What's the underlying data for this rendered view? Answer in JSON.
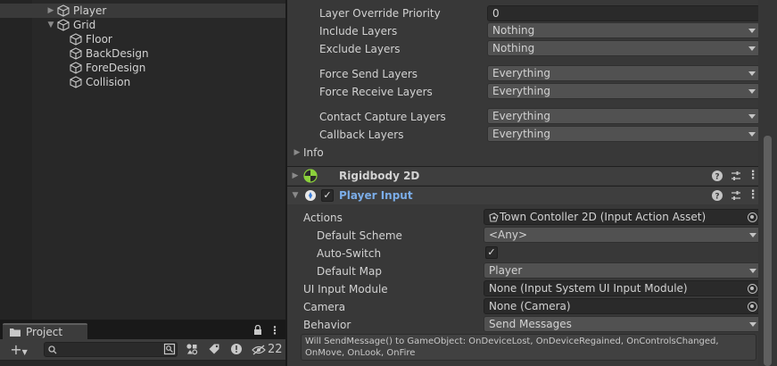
{
  "hierarchy": {
    "items": [
      {
        "label": "Player",
        "expanded": false,
        "icon": "cube-icon"
      },
      {
        "label": "Grid",
        "expanded": true,
        "icon": "cube-icon"
      },
      {
        "label": "Floor",
        "icon": "cube-icon"
      },
      {
        "label": "BackDesign",
        "icon": "cube-icon"
      },
      {
        "label": "ForeDesign",
        "icon": "cube-icon"
      },
      {
        "label": "Collision",
        "icon": "cube-icon"
      }
    ]
  },
  "project": {
    "tab_label": "Project",
    "tab_icon": "folder-icon",
    "search_placeholder": "",
    "hidden_count": "22"
  },
  "inspector": {
    "layer_override_priority": {
      "label": "Layer Override Priority",
      "value": "0"
    },
    "include_layers": {
      "label": "Include Layers",
      "value": "Nothing"
    },
    "exclude_layers": {
      "label": "Exclude Layers",
      "value": "Nothing"
    },
    "force_send_layers": {
      "label": "Force Send Layers",
      "value": "Everything"
    },
    "force_receive_layers": {
      "label": "Force Receive Layers",
      "value": "Everything"
    },
    "contact_capture_layers": {
      "label": "Contact Capture Layers",
      "value": "Everything"
    },
    "callback_layers": {
      "label": "Callback Layers",
      "value": "Everything"
    },
    "info_label": "Info",
    "rigidbody": {
      "title": "Rigidbody 2D"
    },
    "player_input": {
      "title": "Player Input",
      "enabled": true,
      "actions": {
        "label": "Actions",
        "value": "Town Contoller 2D (Input Action Asset)"
      },
      "default_scheme": {
        "label": "Default Scheme",
        "value": "<Any>"
      },
      "auto_switch": {
        "label": "Auto-Switch",
        "checked": true
      },
      "default_map": {
        "label": "Default Map",
        "value": "Player"
      },
      "ui_input_module": {
        "label": "UI Input Module",
        "value": "None (Input System UI Input Module)"
      },
      "camera": {
        "label": "Camera",
        "value": "None (Camera)"
      },
      "behavior": {
        "label": "Behavior",
        "value": "Send Messages"
      },
      "help_text": "Will SendMessage() to GameObject: OnDeviceLost, OnDeviceRegained, OnControlsChanged, OnMove, OnLook, OnFire"
    }
  },
  "colors": {
    "accent_title": "#7bade8",
    "background": "#383838"
  }
}
